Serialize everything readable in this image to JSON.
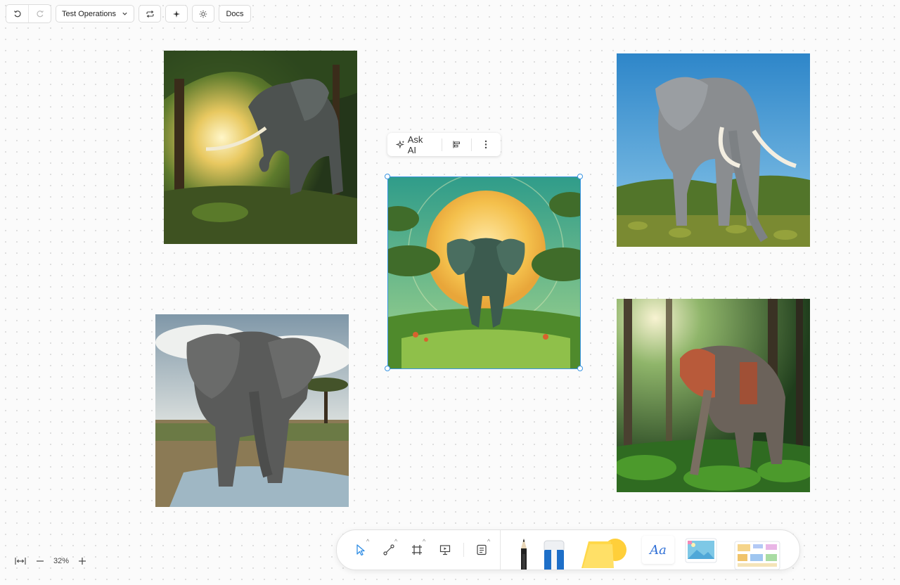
{
  "toolbar": {
    "undo_icon": "undo-icon",
    "redo_icon": "redo-icon",
    "workspace_dropdown_label": "Test Operations",
    "sync_icon": "sync-icon",
    "magic_icon": "sparkle-icon",
    "theme_icon": "sun-icon",
    "docs_label": "Docs"
  },
  "ai_popover": {
    "ask_label": "Ask AI",
    "align_icon": "align-icon",
    "more_icon": "more-vertical-icon"
  },
  "zoom": {
    "fit_icon": "fit-width-icon",
    "level": "32%",
    "zoom_out_icon": "minus-icon",
    "zoom_in_icon": "plus-icon"
  },
  "bottom_toolbar": {
    "tools": [
      "select-tool",
      "connector-tool",
      "frame-tool",
      "presentation-tool",
      "note-tool"
    ],
    "drawers": [
      "pencil",
      "eraser",
      "sticky-note",
      "text",
      "image",
      "template"
    ],
    "text_tool_label": "Aa"
  },
  "canvas": {
    "images": [
      "elephant-forest-sunlight",
      "elephant-moon-savanna",
      "elephant-blue-sky-grassland",
      "elephant-waterhole-savanna",
      "elephant-jungle-red-cloth"
    ]
  },
  "colors": {
    "selection": "#3a95e3",
    "sticky_yellow": "#ffd84a",
    "text_tool_blue": "#2f6fd6"
  }
}
